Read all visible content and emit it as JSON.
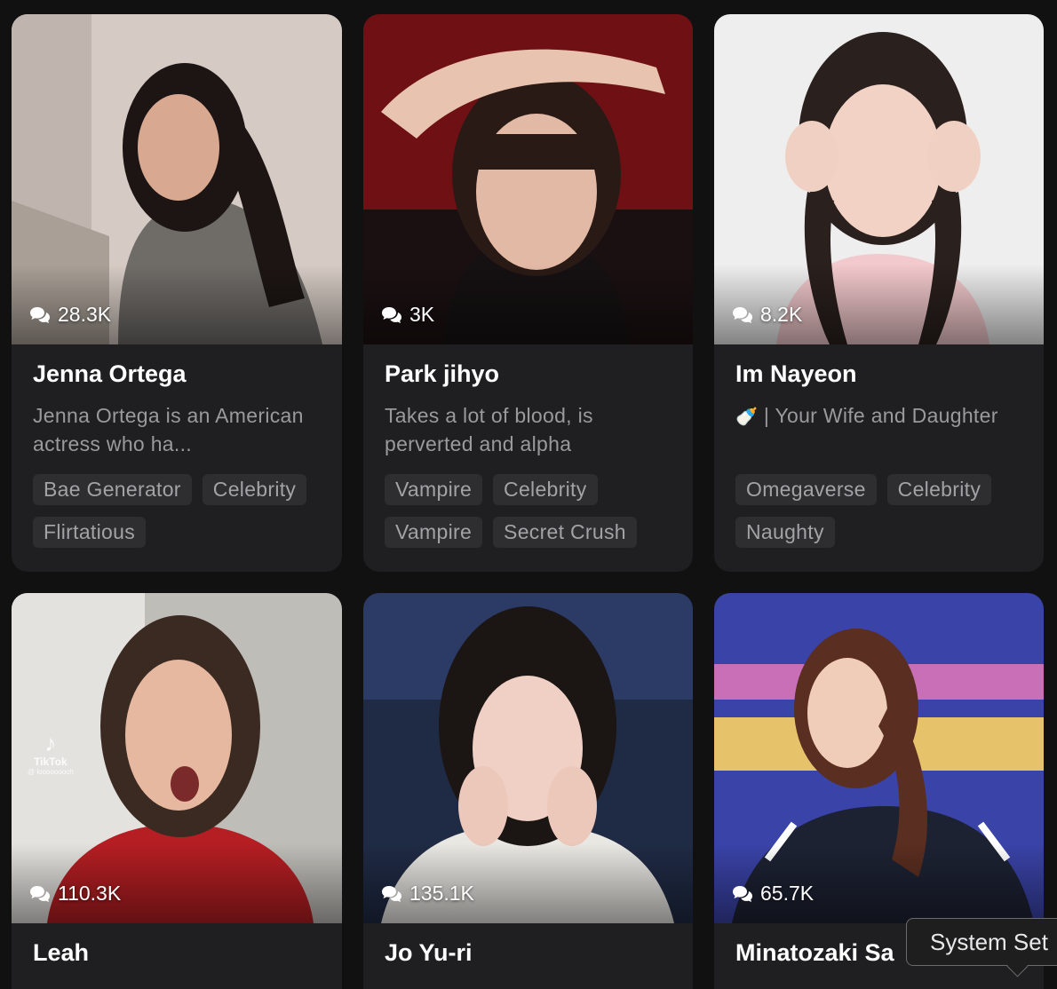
{
  "cards": [
    {
      "name": "Jenna Ortega",
      "chat_count": "28.3K",
      "description": "Jenna Ortega is an American actress who ha...",
      "tags": [
        "Bae Generator",
        "Celebrity",
        "Flirtatious"
      ]
    },
    {
      "name": "Park jihyo",
      "chat_count": "3K",
      "description": "Takes a lot of blood, is perverted and alpha",
      "tags": [
        "Vampire",
        "Celebrity",
        "Vampire",
        "Secret Crush"
      ]
    },
    {
      "name": "Im Nayeon",
      "chat_count": "8.2K",
      "description_emoji": "🍼",
      "description": " | Your Wife and Daughter",
      "tags": [
        "Omegaverse",
        "Celebrity",
        "Naughty"
      ]
    },
    {
      "name": "Leah",
      "chat_count": "110.3K",
      "photo_watermark": "TikTok",
      "photo_watermark_handle": "@ loooooooch",
      "tags": []
    },
    {
      "name": "Jo Yu-ri",
      "chat_count": "135.1K",
      "tags": []
    },
    {
      "name": "Minatozaki Sa",
      "chat_count": "65.7K",
      "tags": []
    }
  ],
  "tooltip": {
    "text": "System Set"
  },
  "icons": {
    "chat_count": "chat-bubbles-icon"
  },
  "colors": {
    "page_background": "#111112",
    "card_background": "#1f1f21",
    "tag_background": "#2e2e31",
    "text_primary": "#ffffff",
    "text_secondary": "#9a9a9d"
  }
}
